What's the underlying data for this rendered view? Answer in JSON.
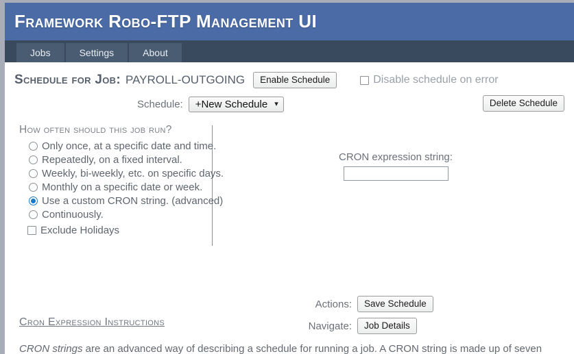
{
  "window": {
    "header_title": "Framework Robo-FTP Management UI",
    "header_color": "#4a6ba5",
    "tabbar_color": "#3a4a5e",
    "accent_color": "#1878c8"
  },
  "tabs": [
    {
      "label": "Jobs"
    },
    {
      "label": "Settings"
    },
    {
      "label": "About"
    }
  ],
  "job_header": {
    "heading": "Schedule for Job:",
    "job_name": "PAYROLL-OUTGOING",
    "enable_button": "Enable Schedule",
    "disable_on_error_label": "Disable schedule on error",
    "disable_on_error_checked": false
  },
  "schedule_row": {
    "label": "Schedule:",
    "selected_option": "+New Schedule",
    "options": [
      "+New Schedule"
    ],
    "caret_icon": "chevron-down-icon",
    "delete_button": "Delete Schedule"
  },
  "frequency": {
    "heading": "How often should this job run?",
    "options": [
      {
        "label": "Only once, at a specific date and time.",
        "selected": false
      },
      {
        "label": "Repeatedly, on a fixed interval.",
        "selected": false
      },
      {
        "label": "Weekly, bi-weekly, etc. on specific days.",
        "selected": false
      },
      {
        "label": "Monthly on a specific date or week.",
        "selected": false
      },
      {
        "label": "Use a custom CRON string. (advanced)",
        "selected": true
      },
      {
        "label": "Continuously.",
        "selected": false
      }
    ],
    "exclude_holidays_label": "Exclude Holidays",
    "exclude_holidays_checked": false
  },
  "cron": {
    "label": "CRON expression string:",
    "value": "",
    "placeholder": ""
  },
  "actions": {
    "actions_label": "Actions:",
    "save_button": "Save Schedule",
    "navigate_label": "Navigate:",
    "job_details_button": "Job Details"
  },
  "instructions": {
    "heading": "Cron Expression Instructions",
    "body_italic": "CRON strings",
    "body_rest": " are an advanced way of describing a schedule for running a job. A CRON string is made up of seven"
  }
}
